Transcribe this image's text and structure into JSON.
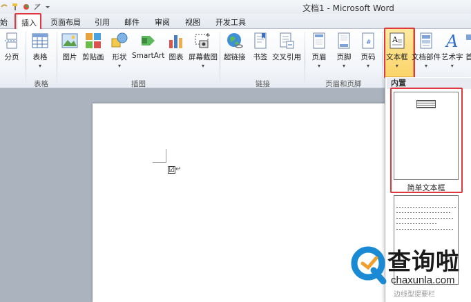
{
  "window": {
    "title": "文档1 - Microsoft Word"
  },
  "tabs": [
    {
      "id": "start",
      "label": "始"
    },
    {
      "id": "insert",
      "label": "插入"
    },
    {
      "id": "layout",
      "label": "页面布局"
    },
    {
      "id": "references",
      "label": "引用"
    },
    {
      "id": "mailings",
      "label": "邮件"
    },
    {
      "id": "review",
      "label": "审阅"
    },
    {
      "id": "view",
      "label": "视图"
    },
    {
      "id": "developer",
      "label": "开发工具"
    }
  ],
  "ribbon": {
    "buttons": {
      "page_break": "分页",
      "table": "表格",
      "picture": "图片",
      "clipart": "剪贴画",
      "shapes": "形状",
      "smartart": "SmartArt",
      "chart": "图表",
      "screenshot": "屏幕截图",
      "hyperlink": "超链接",
      "bookmark": "书签",
      "crossref": "交叉引用",
      "header": "页眉",
      "footer": "页脚",
      "page_number": "页码",
      "textbox": "文本框",
      "quick_parts": "文档部件",
      "wordart": "艺术字",
      "dropcap": "首"
    },
    "groups": {
      "tables": "表格",
      "illustrations": "插图",
      "links": "链接",
      "header_footer": "页眉和页脚"
    },
    "dropdown_arrow": "▾"
  },
  "document": {
    "checkbox_mark": "☑",
    "paragraph_mark": "↵"
  },
  "gallery": {
    "header": "内置",
    "first_item": "简单文本框",
    "partial_item": "边线型提要栏"
  },
  "watermark": {
    "brand": "查询啦",
    "url": "chaxunla.com"
  },
  "colors": {
    "highlight_red": "#e0383e",
    "selected_button": "#fbd46a",
    "watermark_blue": "#1a8ad4"
  }
}
